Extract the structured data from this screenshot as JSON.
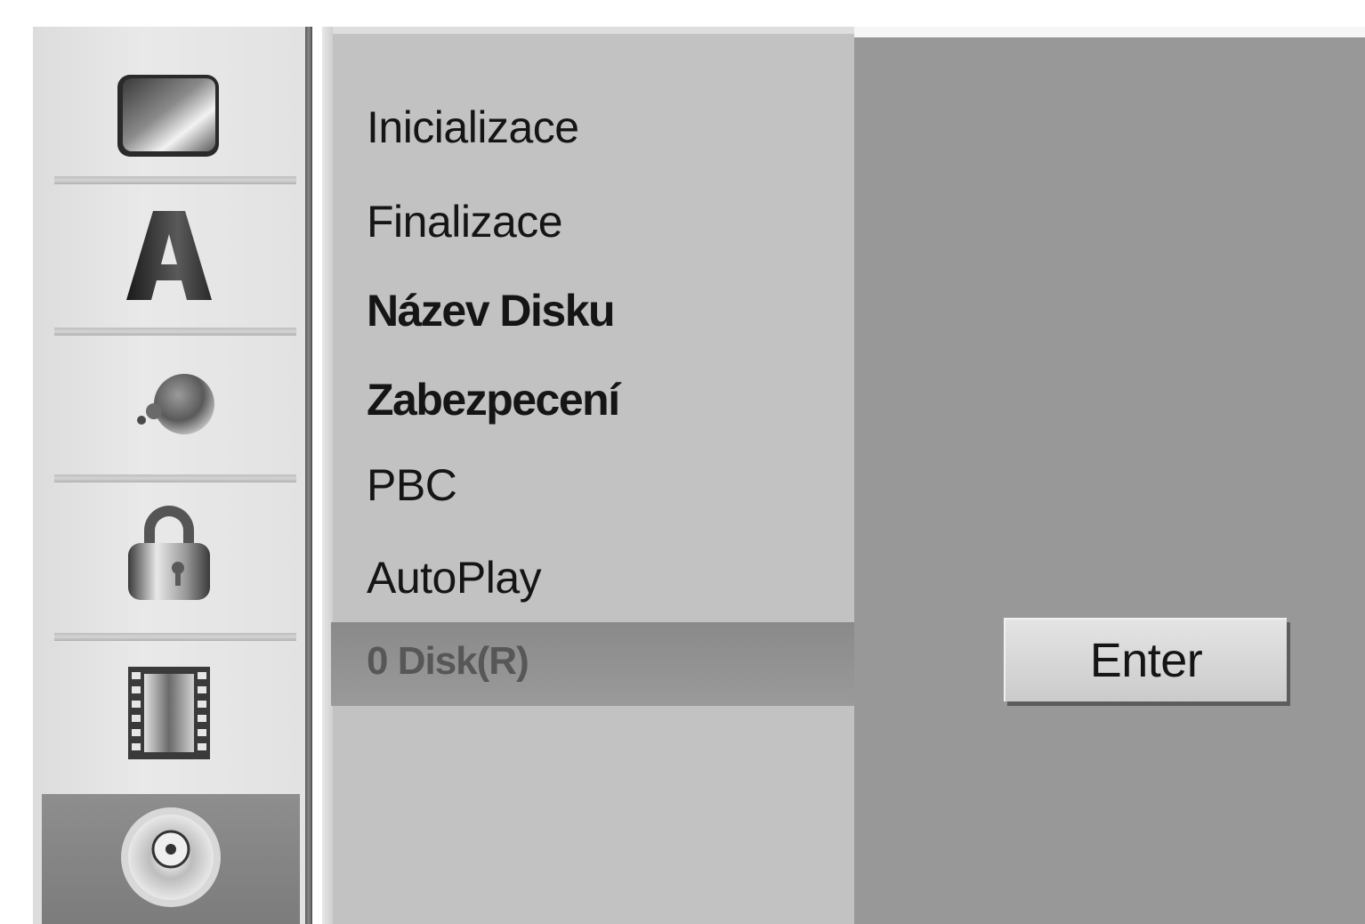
{
  "sidebar": {
    "items": [
      {
        "icon": "tv-screen-icon"
      },
      {
        "icon": "letter-a-icon"
      },
      {
        "icon": "audio-sphere-icon"
      },
      {
        "icon": "padlock-icon"
      },
      {
        "icon": "film-strip-icon"
      },
      {
        "icon": "disc-icon",
        "active": true
      }
    ]
  },
  "menu": {
    "items": [
      {
        "label": "Inicializace"
      },
      {
        "label": "Finalizace"
      },
      {
        "label": "Název Disku"
      },
      {
        "label": "Zabezpecení"
      },
      {
        "label": "PBC"
      },
      {
        "label": "AutoPlay"
      }
    ],
    "disk_type": "0 Disk(R)"
  },
  "right": {
    "enter_label": "Enter"
  },
  "colors": {
    "sidebar_bg": "#e2e2e2",
    "menu_bg": "#c2c2c2",
    "highlight": "#8a8a8a",
    "right_bg": "#989898",
    "button_bg": "#d8d8d8"
  }
}
